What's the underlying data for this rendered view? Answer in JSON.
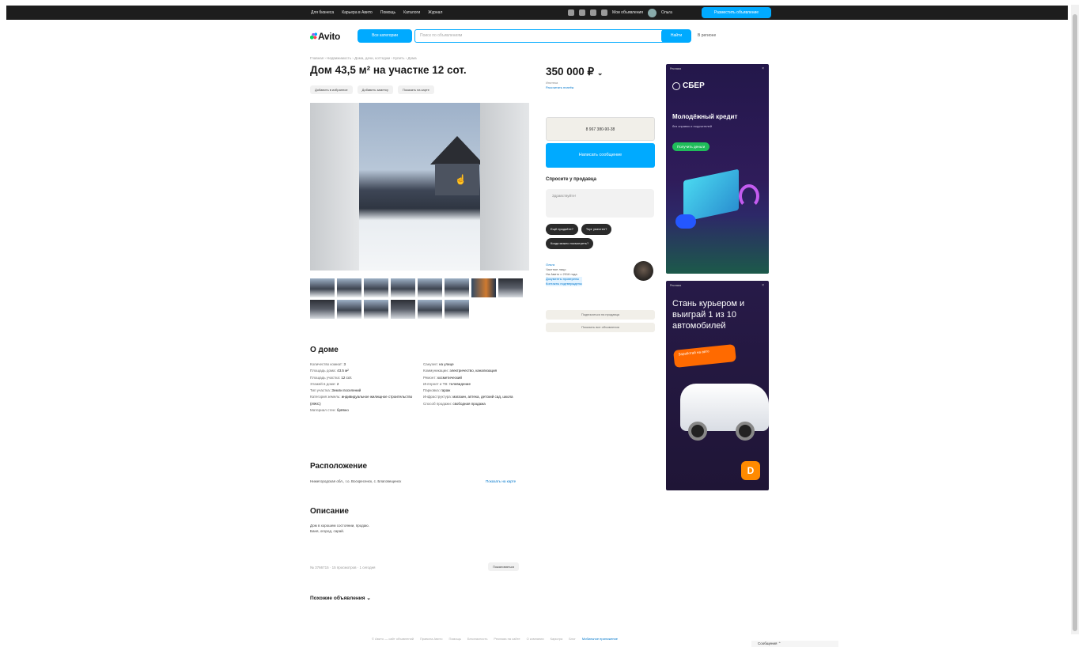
{
  "topbar": {
    "nav": [
      "Для бизнеса",
      "Карьера в Авито",
      "Помощь",
      "Каталоги",
      "Журнал"
    ],
    "my_ads": "Мои объявления",
    "user": "Ольга",
    "post_button": "Разместить объявление"
  },
  "header": {
    "logo": "Avito",
    "categories_button": "Все категории",
    "search_placeholder": "Поиск по объявлениям",
    "search_button": "Найти",
    "location": "В регионе"
  },
  "listing": {
    "breadcrumbs": "Главная › Недвижимость › Дома, дачи, коттеджи › Купить › Дома",
    "title": "Дом 43,5 м² на участке 12 сот.",
    "actions": [
      "Добавить в избранное",
      "Добавить заметку",
      "Показать на карте"
    ],
    "price": "350 000 ₽",
    "price_sub": [
      "Ипотека",
      "Рассчитать платёж"
    ],
    "phone_button": "8 967 380-90-38",
    "message_button": "Написать сообщение",
    "ask_title": "Спросите у продавца",
    "ask_placeholder": "Здравствуйте!",
    "quick_questions": [
      "Ещё продаёте?",
      "Торг уместен?",
      "Когда можно посмотреть?"
    ],
    "seller": {
      "name": "Ольга",
      "type": "Частное лицо",
      "since": "На Авито с 2016 года",
      "verified": "Документы проверены",
      "reviews": "Контакты подтверждены"
    },
    "seller_buttons": [
      "Подписаться на продавца",
      "Показать все объявления"
    ]
  },
  "about": {
    "title": "О доме",
    "left": [
      {
        "k": "Количество комнат:",
        "v": "3"
      },
      {
        "k": "Площадь дома:",
        "v": "43.5 м²"
      },
      {
        "k": "Площадь участка:",
        "v": "12 сот."
      },
      {
        "k": "Этажей в доме:",
        "v": "2"
      },
      {
        "k": "Тип участка:",
        "v": "Земли поселений"
      },
      {
        "k": "Категория земель:",
        "v": "индивидуальное жилищное строительство (ИЖС)"
      },
      {
        "k": "Материал стен:",
        "v": "брёвно"
      }
    ],
    "right": [
      {
        "k": "Санузел:",
        "v": "на улице"
      },
      {
        "k": "Коммуникации:",
        "v": "электричество, канализация"
      },
      {
        "k": "Ремонт:",
        "v": "косметический"
      },
      {
        "k": "Интернет и ТВ:",
        "v": "телевидение"
      },
      {
        "k": "Парковка:",
        "v": "гараж"
      },
      {
        "k": "Инфраструктура:",
        "v": "магазин, аптека, детский сад, школа"
      },
      {
        "k": "Способ продажи:",
        "v": "свободная продажа"
      }
    ]
  },
  "location": {
    "title": "Расположение",
    "address": "Нижегородская обл., г.о. Воскресенск, с. Благовещенск",
    "map_link": "Показать на карте"
  },
  "description": {
    "title": "Описание",
    "lines": [
      "Дом в хорошем состоянии, продаю.",
      "Баня, огород, сарай."
    ]
  },
  "listing_meta": {
    "text": "№ 3766715 · 15 просмотров · 1 сегодня",
    "report_button": "Пожаловаться"
  },
  "similar": {
    "title": "Похожие объявления"
  },
  "ads": {
    "ad1": {
      "label": "Реклама",
      "brand": "СБЕР",
      "headline": "Молодёжный кредит",
      "note": "без справок и поручителей",
      "cta": "Получить деньги"
    },
    "ad2": {
      "label": "Реклама",
      "headline": "Стань курьером и выиграй 1 из 10 автомобилей",
      "cta": "Заработай на авто"
    }
  },
  "footer": {
    "links": [
      "© Авито — сайт объявлений",
      "Правила Авито",
      "Помощь",
      "Безопасность",
      "Реклама на сайте",
      "О компании",
      "Карьера",
      "Блог",
      "Мобильное приложение"
    ]
  },
  "messenger_bar": {
    "label": "Сообщения"
  }
}
